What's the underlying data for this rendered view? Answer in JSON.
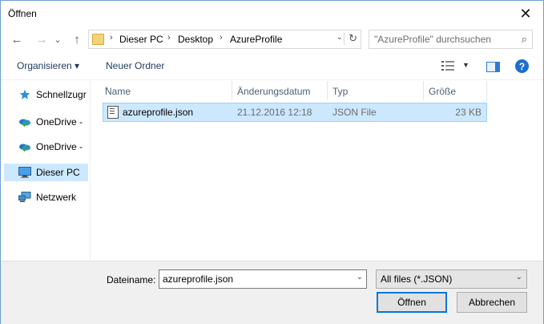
{
  "window": {
    "title": "Öffnen",
    "close": "✕"
  },
  "nav": {
    "back": "←",
    "forward": "→",
    "recent": "⌄",
    "up": "↑"
  },
  "address": {
    "crumbs": [
      "Dieser PC",
      "Desktop",
      "AzureProfile"
    ],
    "separator": "›",
    "dropdown": "⌄",
    "refresh": "↻"
  },
  "search": {
    "placeholder": "\"AzureProfile\" durchsuchen",
    "icon": "⌕"
  },
  "toolbar": {
    "organize": "Organisieren ▾",
    "new_folder": "Neuer Ordner",
    "view_drop": "▼",
    "help": "?"
  },
  "sidebar": {
    "items": [
      {
        "label": "Schnellzugr",
        "icon": "star-icon"
      },
      {
        "label": "OneDrive -",
        "icon": "onedrive-icon"
      },
      {
        "label": "OneDrive -",
        "icon": "onedrive-icon"
      },
      {
        "label": "Dieser PC",
        "icon": "computer-icon",
        "selected": true
      },
      {
        "label": "Netzwerk",
        "icon": "network-icon"
      }
    ]
  },
  "columns": {
    "name": "Name",
    "modified": "Änderungsdatum",
    "type": "Typ",
    "size": "Größe",
    "sort_indicator": "^"
  },
  "files": [
    {
      "name": "azureprofile.json",
      "modified": "21.12.2016 12:18",
      "type": "JSON File",
      "size": "23 KB"
    }
  ],
  "bottom": {
    "filename_label": "Dateiname:",
    "filename_value": "azureprofile.json",
    "filetype_value": "All files (*.JSON)",
    "dropdown": "⌄",
    "open_label": "Öffnen",
    "cancel_label": "Abbrechen"
  }
}
